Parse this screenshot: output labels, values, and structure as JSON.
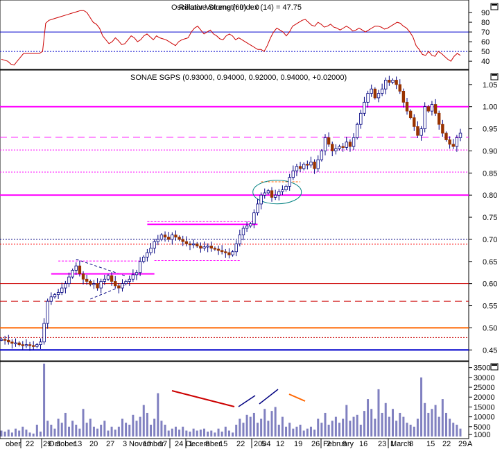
{
  "chart_data": [
    {
      "type": "line",
      "panel": "rsi",
      "title": "Relative Strength Index (14) = 47.75",
      "title_overlay": "Oscillator Volume (60) = 0",
      "y_ticks": [
        40,
        50,
        60,
        70,
        80,
        90
      ],
      "ylim": [
        33,
        100
      ],
      "reference_lines": [
        {
          "value": 70,
          "style": "solid",
          "color": "#0000cc"
        },
        {
          "value": 50,
          "style": "dotted",
          "color": "#0000cc"
        }
      ],
      "series": [
        {
          "color": "#cc0000",
          "values": [
            42,
            41,
            40,
            37,
            36,
            40,
            44,
            48,
            48,
            48,
            48,
            48,
            48,
            50,
            79,
            82,
            83,
            84,
            85,
            86,
            87,
            88,
            89,
            90,
            91,
            92,
            92,
            90,
            85,
            80,
            78,
            74,
            66,
            62,
            58,
            60,
            64,
            61,
            57,
            58,
            62,
            66,
            64,
            60,
            62,
            66,
            68,
            65,
            62,
            66,
            64,
            63,
            62,
            60,
            58,
            56,
            60,
            62,
            63,
            64,
            70,
            74,
            76,
            72,
            68,
            70,
            72,
            68,
            66,
            63,
            62,
            66,
            68,
            66,
            62,
            64,
            62,
            60,
            58,
            56,
            54,
            52,
            52,
            50,
            56,
            64,
            70,
            74,
            72,
            70,
            66,
            70,
            76,
            78,
            80,
            82,
            83,
            80,
            77,
            76,
            80,
            78,
            75,
            76,
            78,
            75,
            74,
            72,
            74,
            76,
            74,
            71,
            72,
            74,
            72,
            70,
            72,
            74,
            76,
            76,
            75,
            73,
            74,
            76,
            78,
            80,
            79,
            76,
            74,
            70,
            65,
            56,
            52,
            47,
            46,
            50,
            46,
            45,
            50,
            48,
            45,
            42,
            40,
            45,
            48,
            46
          ]
        }
      ]
    },
    {
      "type": "candlestick",
      "panel": "price",
      "title": "SONAE SGPS (0.93000, 0.94000, 0.92000, 0.94000, +0.02000)",
      "y_ticks": [
        0.45,
        0.5,
        0.55,
        0.6,
        0.65,
        0.7,
        0.75,
        0.8,
        0.85,
        0.9,
        0.95,
        1.0,
        1.05
      ],
      "ylim": [
        0.43,
        1.078
      ],
      "x_labels": [
        "ober",
        "22",
        "29",
        "October",
        "6",
        "13",
        "20",
        "27",
        "3",
        "November",
        "10",
        "17",
        "24",
        "1",
        "December",
        "8",
        "15",
        "22",
        "2004",
        "5",
        "12",
        "19",
        "26",
        "February",
        "2",
        "9",
        "16",
        "23",
        "March",
        "1",
        "8",
        "15",
        "22",
        "29",
        "A"
      ],
      "close": [
        0.474,
        0.472,
        0.468,
        0.465,
        0.466,
        0.462,
        0.46,
        0.462,
        0.46,
        0.458,
        0.462,
        0.468,
        0.51,
        0.56,
        0.57,
        0.575,
        0.58,
        0.59,
        0.6,
        0.615,
        0.63,
        0.64,
        0.622,
        0.61,
        0.605,
        0.598,
        0.6,
        0.59,
        0.605,
        0.61,
        0.618,
        0.605,
        0.595,
        0.59,
        0.6,
        0.605,
        0.61,
        0.62,
        0.625,
        0.65,
        0.66,
        0.67,
        0.68,
        0.695,
        0.7,
        0.71,
        0.705,
        0.7,
        0.71,
        0.705,
        0.7,
        0.695,
        0.69,
        0.688,
        0.69,
        0.685,
        0.68,
        0.683,
        0.685,
        0.68,
        0.678,
        0.675,
        0.672,
        0.67,
        0.665,
        0.672,
        0.69,
        0.71,
        0.725,
        0.73,
        0.735,
        0.76,
        0.78,
        0.8,
        0.805,
        0.81,
        0.795,
        0.8,
        0.808,
        0.812,
        0.82,
        0.84,
        0.855,
        0.865,
        0.86,
        0.87,
        0.868,
        0.875,
        0.86,
        0.88,
        0.9,
        0.93,
        0.915,
        0.9,
        0.905,
        0.91,
        0.908,
        0.92,
        0.91,
        0.93,
        0.96,
        0.985,
        1.01,
        1.03,
        1.04,
        1.02,
        1.03,
        1.04,
        1.06,
        1.055,
        1.06,
        1.05,
        1.035,
        1.01,
        0.99,
        0.975,
        0.955,
        0.935,
        0.95,
        1.0,
        0.99,
        1.005,
        0.985,
        0.96,
        0.94,
        0.925,
        0.915,
        0.91,
        0.93,
        0.94
      ],
      "reference_lines": [
        {
          "value": 1.0,
          "style": "solid",
          "color": "#ff00ff",
          "width": 2
        },
        {
          "value": 0.931,
          "style": "dashed",
          "color": "#ff00ff",
          "width": 1
        },
        {
          "value": 0.902,
          "style": "dotted",
          "color": "#ff00ff",
          "width": 1
        },
        {
          "value": 0.852,
          "style": "dotted",
          "color": "#ff00ff",
          "width": 1
        },
        {
          "value": 0.8,
          "style": "solid",
          "color": "#ff00ff",
          "width": 2
        },
        {
          "value": 0.7,
          "style": "dotted",
          "color": "#000080",
          "width": 1
        },
        {
          "value": 0.689,
          "style": "dotted",
          "color": "#ff0000",
          "width": 1
        },
        {
          "value": 0.6,
          "style": "solid",
          "color": "#cc0000",
          "width": 1
        },
        {
          "value": 0.56,
          "style": "dashed",
          "color": "#cc0000",
          "width": 1
        },
        {
          "value": 0.5,
          "style": "solid",
          "color": "#ff6600",
          "width": 2
        },
        {
          "value": 0.478,
          "style": "dotted",
          "color": "#cc0000",
          "width": 1
        },
        {
          "value": 0.45,
          "style": "solid",
          "color": "#0000cc",
          "width": 2
        }
      ]
    },
    {
      "type": "bar",
      "panel": "volume",
      "y_ticks": [
        35000,
        30000,
        25000,
        20000,
        15000,
        10000,
        5000,
        1000
      ],
      "y_tick_labels": [
        "35000",
        "30000",
        "25000",
        "20000",
        "15000",
        "10000",
        "5000",
        "1000"
      ],
      "ylim": [
        0,
        37000
      ],
      "x_labels": [
        "ober",
        "22",
        "29",
        "October",
        "6",
        "13",
        "20",
        "27",
        "3",
        "November",
        "10",
        "17",
        "24",
        "1",
        "December",
        "8",
        "15",
        "22",
        "2004",
        "5",
        "12",
        "19",
        "26",
        "February",
        "2",
        "9",
        "16",
        "23",
        "March",
        "1",
        "8",
        "15",
        "22",
        "29",
        "A"
      ],
      "values": [
        3000,
        2500,
        3500,
        2000,
        4000,
        3000,
        5000,
        3500,
        2000,
        1500,
        6000,
        2500,
        37000,
        8000,
        6000,
        4000,
        9000,
        7000,
        12000,
        5000,
        8000,
        6000,
        4000,
        14000,
        7000,
        9000,
        5000,
        4000,
        6000,
        8000,
        3000,
        5000,
        3500,
        5000,
        9000,
        7000,
        6000,
        11000,
        8000,
        10000,
        16000,
        12000,
        6000,
        9000,
        22000,
        8000,
        6000,
        3000,
        4000,
        5000,
        3500,
        5000,
        3000,
        2500,
        4000,
        3000,
        3500,
        4000,
        2500,
        3000,
        2000,
        4000,
        2500,
        5000,
        3000,
        2000,
        6000,
        9000,
        7000,
        11000,
        10000,
        12000,
        7000,
        9000,
        14000,
        8000,
        13000,
        15000,
        6000,
        10000,
        5000,
        7000,
        4000,
        5000,
        6000,
        3000,
        4000,
        5000,
        3500,
        9000,
        7000,
        12000,
        6000,
        8000,
        10000,
        7000,
        9000,
        16000,
        8000,
        10000,
        11000,
        6000,
        13000,
        19000,
        14000,
        9000,
        24000,
        12000,
        17000,
        10000,
        14000,
        8000,
        12000,
        10000,
        7000,
        6000,
        5000,
        9000,
        30000,
        17000,
        12000,
        14000,
        16000,
        10000,
        19000,
        12000,
        9000,
        7000,
        6000,
        4000
      ],
      "color": "#8080c0"
    }
  ],
  "overlay_colors": {
    "up_body": "#ffffff",
    "down_body": "#993300",
    "candle_outline": "#000080",
    "wick": "#000080",
    "annotation_line_blue": "#000080",
    "annotation_line_red": "#cc0000",
    "annotation_line_orange": "#ff6600",
    "ellipse": "#008080"
  }
}
